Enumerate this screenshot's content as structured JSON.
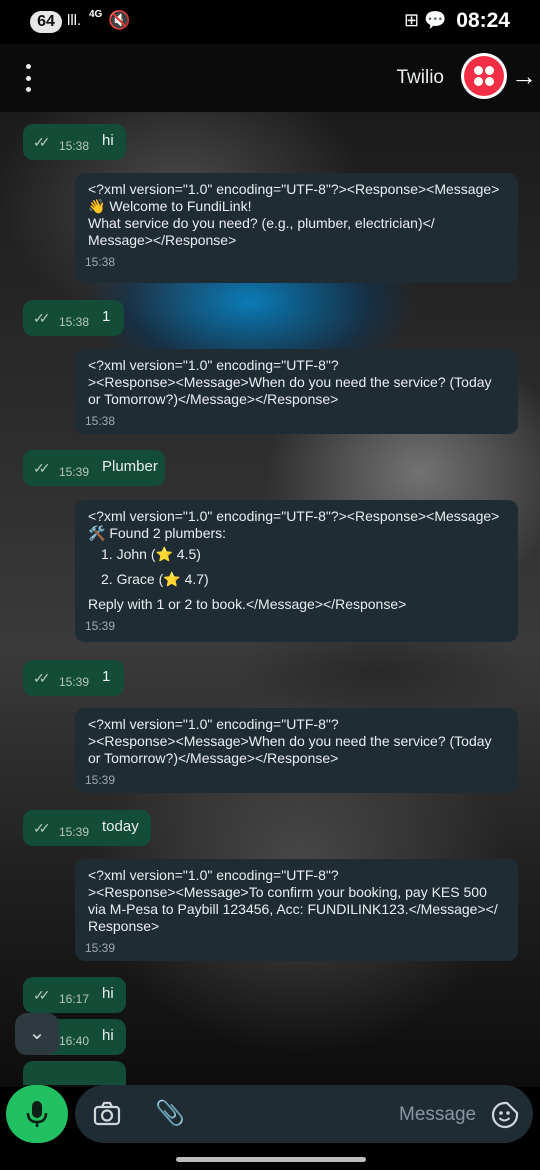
{
  "status_bar": {
    "badge": "64",
    "signal": "lll.",
    "network": "4G",
    "time": "08:24"
  },
  "header": {
    "contact_name": "Twilio"
  },
  "messages": [
    {
      "dir": "out",
      "time": "15:38",
      "text": "hi"
    },
    {
      "dir": "in",
      "time": "15:38",
      "text": "<?xml version=\"1.0\" encoding=\"UTF-8\"?><Response><Message>\n👋 Welcome to FundiLink!\nWhat service do you need? (e.g., plumber, electrician)</\nMessage></Response>"
    },
    {
      "dir": "out",
      "time": "15:38",
      "text": "1"
    },
    {
      "dir": "in",
      "time": "15:38",
      "text": "<?xml version=\"1.0\" encoding=\"UTF-8\"?\n><Response><Message>When do you need the service? (Today\nor Tomorrow?)</Message></Response>"
    },
    {
      "dir": "out",
      "time": "15:39",
      "text": "Plumber"
    },
    {
      "dir": "in",
      "time": "15:39",
      "text_top": "<?xml version=\"1.0\" encoding=\"UTF-8\"?><Response><Message>\n🛠️ Found 2 plumbers:",
      "items": [
        "1. John (⭐ 4.5)",
        "2. Grace (⭐ 4.7)"
      ],
      "text_bottom": "Reply with 1 or 2 to book.</Message></Response>"
    },
    {
      "dir": "out",
      "time": "15:39",
      "text": "1"
    },
    {
      "dir": "in",
      "time": "15:39",
      "text": "<?xml version=\"1.0\" encoding=\"UTF-8\"?\n><Response><Message>When do you need the service? (Today\nor Tomorrow?)</Message></Response>"
    },
    {
      "dir": "out",
      "time": "15:39",
      "text": "today"
    },
    {
      "dir": "in",
      "time": "15:39",
      "text": "<?xml version=\"1.0\" encoding=\"UTF-8\"?\n><Response><Message>To confirm your booking, pay KES 500\nvia M-Pesa to Paybill 123456, Acc: FUNDILINK123.</Message></\nResponse>"
    },
    {
      "dir": "out",
      "time": "16:17",
      "text": "hi"
    },
    {
      "dir": "out",
      "time": "16:40",
      "text": "hi"
    }
  ],
  "input": {
    "placeholder": "Message"
  },
  "colors": {
    "outgoing_bubble": "#144d37",
    "incoming_bubble": "#1f2c34",
    "mic_button": "#21c063",
    "avatar": "#f22f46"
  }
}
